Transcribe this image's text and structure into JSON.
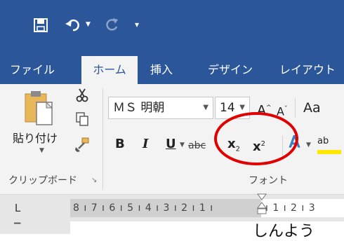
{
  "qat": {
    "save_icon": "floppy-icon",
    "undo_icon": "undo-icon",
    "redo_icon": "redo-icon",
    "customize_icon": "customize-qat-icon"
  },
  "tabs": [
    {
      "label": "ファイル",
      "active": false
    },
    {
      "label": "ホーム",
      "active": true
    },
    {
      "label": "挿入",
      "active": false
    },
    {
      "label": "デザイン",
      "active": false
    },
    {
      "label": "レイアウト",
      "active": false
    }
  ],
  "clipboard": {
    "paste_label": "貼り付け",
    "group_label": "クリップボード"
  },
  "font": {
    "font_name": "ＭＳ 明朝",
    "font_size": "14",
    "grow_label": "A",
    "shrink_label": "A",
    "change_case_label": "Aa",
    "bold_label": "B",
    "italic_label": "I",
    "underline_label": "U",
    "strike_label": "abc",
    "subscript_label": "x",
    "subscript_mark": "2",
    "superscript_label": "x",
    "superscript_mark": "2",
    "text_effects_label": "A",
    "highlight_label": "ab",
    "group_label": "フォント"
  },
  "ruler": {
    "tab_selector": "L",
    "left_numbers": "8 ı 7 ı 6 ı 5 ı 4 ı 3 ı 2 ı 1 ı",
    "right_numbers": "ı 1 ı 2 ı 3"
  },
  "document": {
    "visible_text": "しんよう"
  },
  "colors": {
    "title_bar": "#2b579a",
    "ribbon": "#f3f3f3",
    "highlight_circle": "#e00000"
  }
}
